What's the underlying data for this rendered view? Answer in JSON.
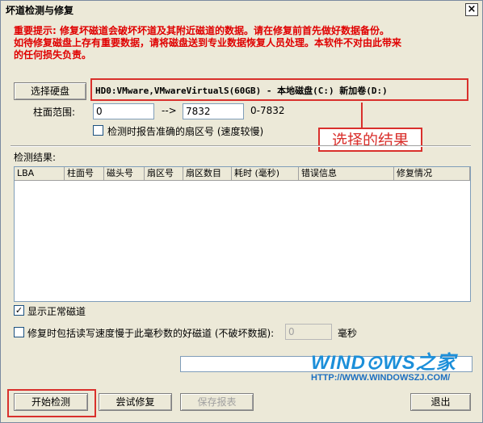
{
  "window": {
    "title": "坏道检测与修复",
    "close_glyph": "×"
  },
  "notice": {
    "line1": "重要提示: 修复坏磁道会破坏坏道及其附近磁道的数据。请在修复前首先做好数据备份。",
    "line2": "如待修复磁盘上存有重要数据，请将磁盘送到专业数据恢复人员处理。本软件不对由此带来",
    "line3": "的任何损失负责。"
  },
  "disk": {
    "select_button": "选择硬盘",
    "info": "HD0:VMware,VMwareVirtualS(60GB) - 本地磁盘(C:) 新加卷(D:)"
  },
  "cylinder": {
    "label": "柱面范围:",
    "from": "0",
    "arrow": "-->",
    "to": "7832",
    "range_hint": "0-7832"
  },
  "options": {
    "report_sector": "检测时报告准确的扇区号 (速度较慢)",
    "show_normal": "显示正常磁道",
    "repair_include": "修复时包括读写速度慢于此毫秒数的好磁道 (不破坏数据):",
    "ms_value": "0",
    "ms_unit": "毫秒"
  },
  "annotation": "选择的结果",
  "results": {
    "label": "检测结果:",
    "columns": [
      "LBA",
      "柱面号",
      "磁头号",
      "扇区号",
      "扇区数目",
      "耗时 (毫秒)",
      "错误信息",
      "修复情况"
    ],
    "rows": []
  },
  "buttons": {
    "start": "开始检测",
    "try_repair": "尝试修复",
    "save_report": "保存报表",
    "exit": "退出"
  },
  "watermark": {
    "brand": "WIND⊙WS之家",
    "url": "HTTP://WWW.WINDOWSZJ.COM/"
  },
  "colors": {
    "notice_red": "#e00000",
    "annotation_red": "#d9302c",
    "dialog_bg": "#ece9d8"
  }
}
